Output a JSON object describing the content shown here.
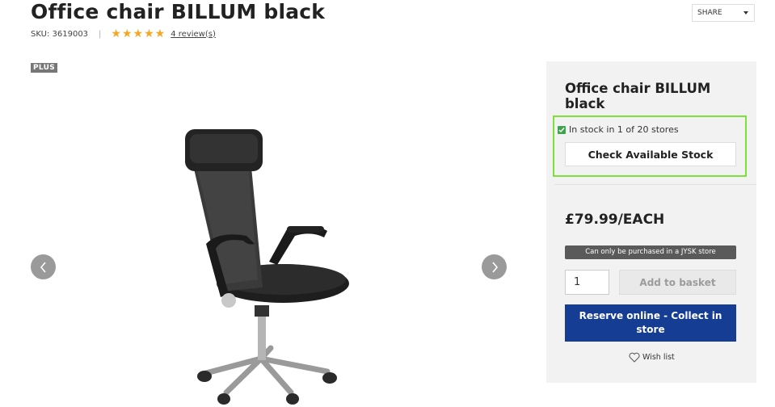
{
  "product": {
    "title": "Office chair BILLUM black",
    "sku": "SKU: 3619003",
    "rating_stars": 5,
    "reviews_link": "4 review(s)",
    "badge": "PLUS"
  },
  "share": {
    "label": "SHARE"
  },
  "panel": {
    "title": "Office chair BILLUM black",
    "stock_text": "In stock in 1 of 20 stores",
    "check_stock_label": "Check Available Stock",
    "price": "£79.99/EACH",
    "store_only_note": "Can only be purchased in a JYSK store",
    "quantity": "1",
    "add_to_basket_label": "Add to basket",
    "reserve_label": "Reserve online - Collect in store",
    "wishlist_label": "Wish list"
  },
  "colors": {
    "accent_blue": "#163d94",
    "star": "#f5a623",
    "stock_highlight": "#7ee13a",
    "stock_check": "#3fa34d",
    "panel_bg": "#f2f2f2"
  },
  "icons": [
    "star-icon",
    "chevron-down-icon",
    "chevron-left-icon",
    "chevron-right-icon",
    "checkbox-icon",
    "heart-icon"
  ]
}
